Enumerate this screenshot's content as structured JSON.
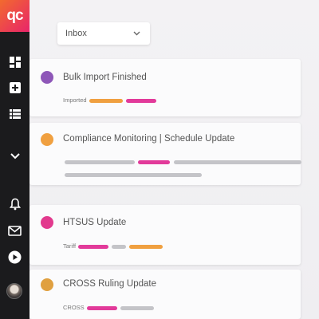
{
  "app": {
    "logo_text": "qc",
    "brand_gradient": [
      "#f26a2e",
      "#e8246a"
    ]
  },
  "sidebar": {
    "items": [
      {
        "name": "dashboard-icon"
      },
      {
        "name": "add-icon"
      },
      {
        "name": "list-icon"
      },
      {
        "name": "chevron-down-icon"
      },
      {
        "name": "bell-icon"
      },
      {
        "name": "mail-icon"
      },
      {
        "name": "play-icon"
      }
    ]
  },
  "inbox": {
    "dropdown_label": "Inbox"
  },
  "notifications": [
    {
      "title": "Bulk Import Finished",
      "dot_color": "#8e57b8",
      "tag_label": "Imported"
    },
    {
      "title": "Compliance Monitoring | Schedule Update",
      "dot_color": "#f0a040"
    },
    {
      "title": "HTSUS Update",
      "dot_color": "#e23a8e",
      "tag_label": "Tariff"
    },
    {
      "title": "CROSS Ruling Update",
      "dot_color": "#e0a040",
      "tag_label": "CROSS"
    }
  ],
  "colors": {
    "orange": "#f0a040",
    "magenta": "#e23a9a",
    "gray": "#c4c4c8",
    "sidebar_bg": "#1b1b1d"
  }
}
